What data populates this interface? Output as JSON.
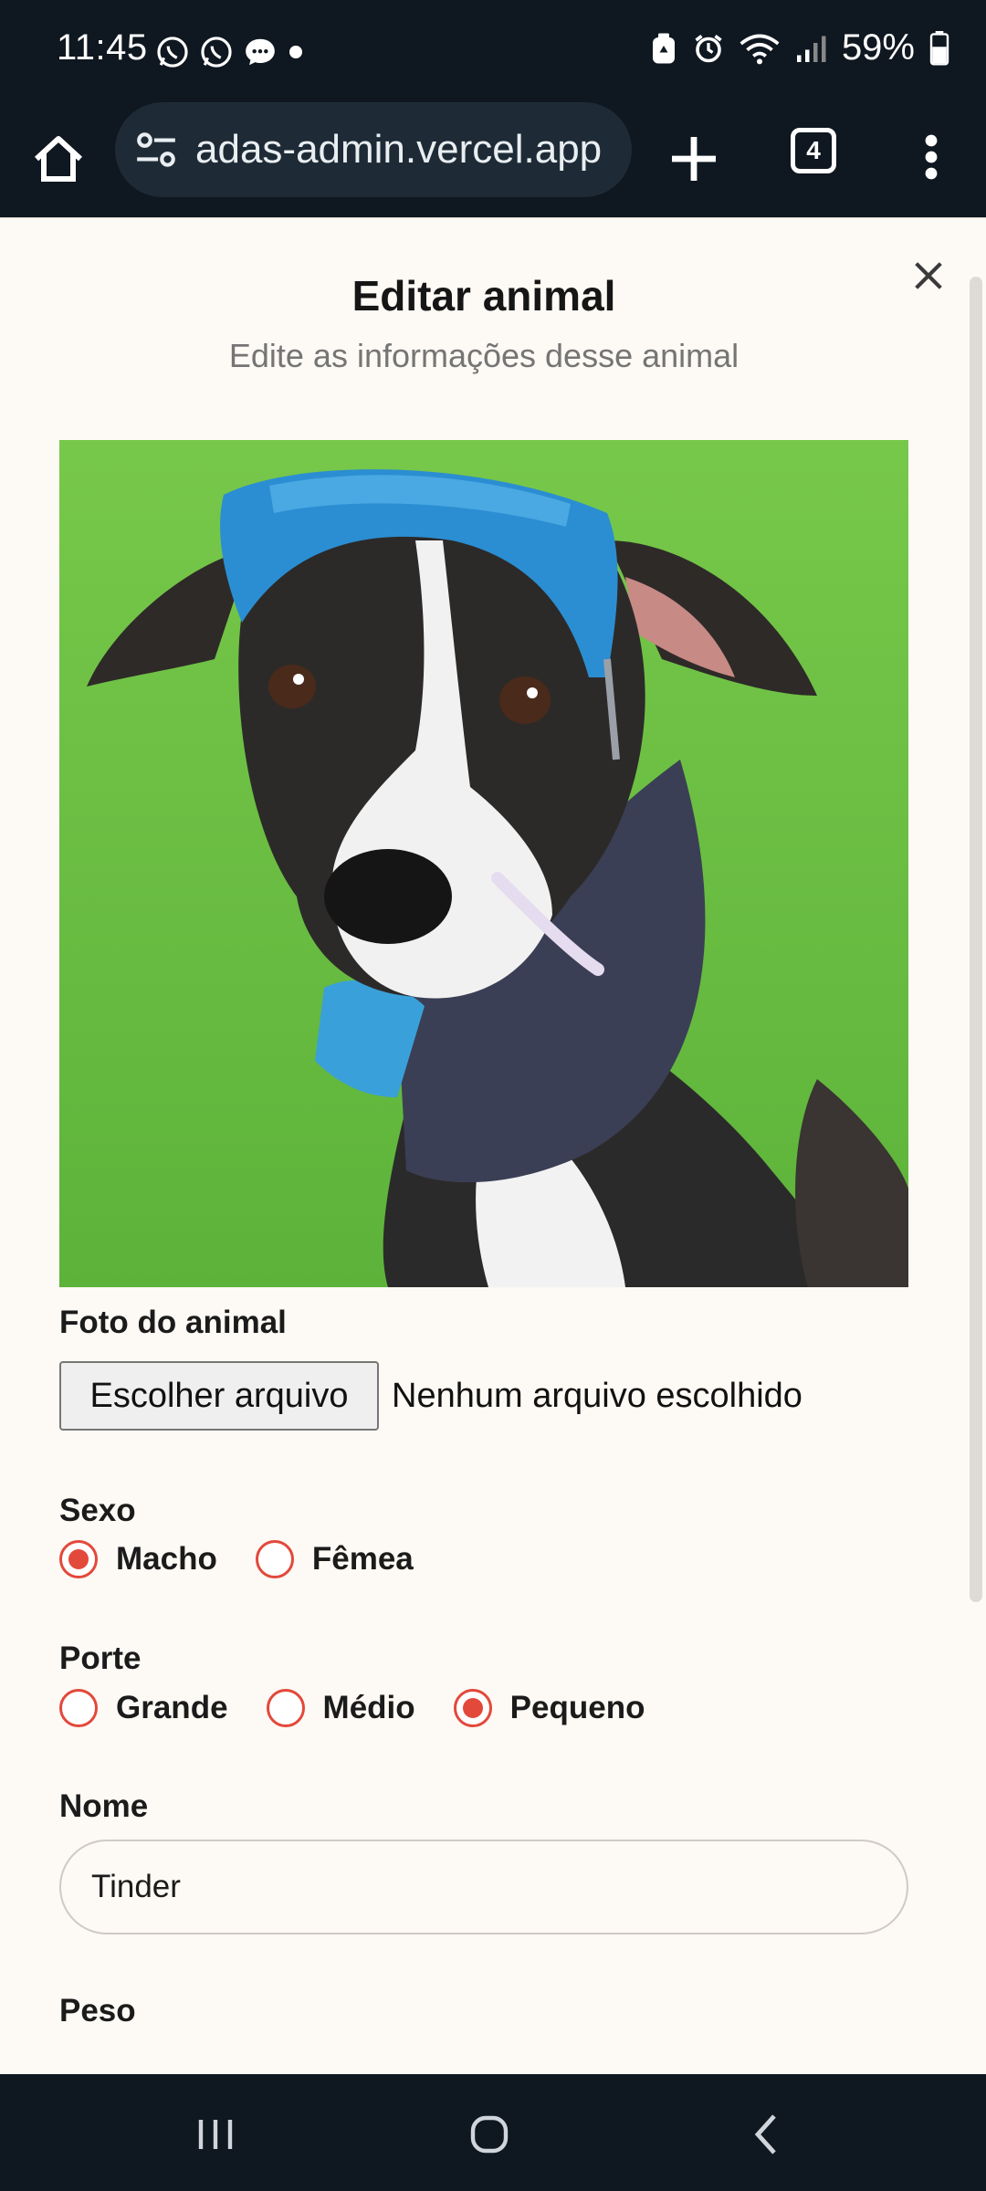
{
  "status_bar": {
    "time": "11:45",
    "battery": "59%",
    "left_icons": [
      "whatsapp-icon",
      "whatsapp-icon",
      "messages-icon",
      "dot-icon"
    ],
    "right_icons": [
      "recycle-lock-icon",
      "alarm-icon",
      "wifi-icon",
      "signal-icon",
      "battery-icon"
    ]
  },
  "browser": {
    "url": "adas-admin.vercel.app",
    "tab_count": "4"
  },
  "modal": {
    "title": "Editar animal",
    "subtitle": "Edite as informações desse animal"
  },
  "photo_field": {
    "label": "Foto do animal",
    "button_label": "Escolher arquivo",
    "status": "Nenhum arquivo escolhido"
  },
  "sexo": {
    "label": "Sexo",
    "options": [
      {
        "label": "Macho",
        "checked": true
      },
      {
        "label": "Fêmea",
        "checked": false
      }
    ]
  },
  "porte": {
    "label": "Porte",
    "options": [
      {
        "label": "Grande",
        "checked": false
      },
      {
        "label": "Médio",
        "checked": false
      },
      {
        "label": "Pequeno",
        "checked": true
      }
    ]
  },
  "nome": {
    "label": "Nome",
    "value": "Tinder"
  },
  "peso": {
    "label": "Peso"
  },
  "colors": {
    "accent": "#e2493b",
    "page_bg": "#fdf9f4",
    "chrome_bg": "#0f1720"
  }
}
